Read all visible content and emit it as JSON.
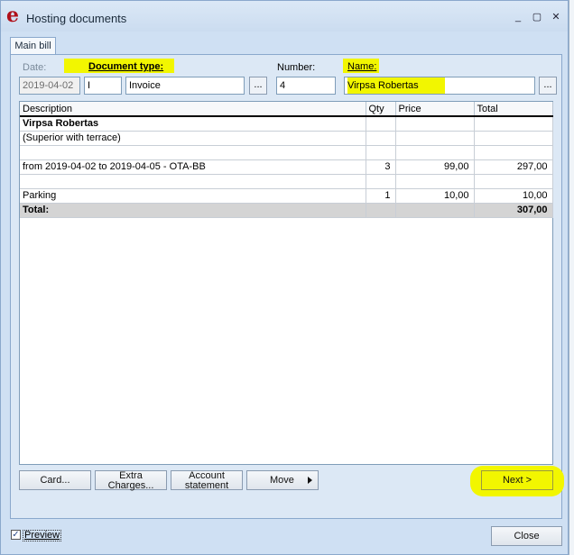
{
  "window": {
    "title": "Hosting documents",
    "controls": {
      "minimize": "_",
      "maximize": "▢",
      "close": "✕"
    }
  },
  "tabs": [
    {
      "label": "Main bill"
    }
  ],
  "form": {
    "date_label": "Date:",
    "date_value": "2019-04-02",
    "doctype_label": "Document type:",
    "doctype_code": "I",
    "doctype_name": "Invoice",
    "number_label": "Number:",
    "number_value": "4",
    "name_label": "Name:",
    "name_value": "Virpsa Robertas",
    "lookup_label": "..."
  },
  "table": {
    "headers": {
      "description": "Description",
      "qty": "Qty",
      "price": "Price",
      "total": "Total"
    },
    "rows": [
      {
        "description": "Virpsa Robertas",
        "qty": "",
        "price": "",
        "total": ""
      },
      {
        "description": "(Superior with terrace)",
        "qty": "",
        "price": "",
        "total": ""
      },
      {
        "description": "",
        "qty": "",
        "price": "",
        "total": ""
      },
      {
        "description": "from 2019-04-02 to 2019-04-05 - OTA-BB",
        "qty": "3",
        "price": "99,00",
        "total": "297,00"
      },
      {
        "description": "",
        "qty": "",
        "price": "",
        "total": ""
      },
      {
        "description": "Parking",
        "qty": "1",
        "price": "10,00",
        "total": "10,00"
      },
      {
        "description": "Total:",
        "qty": "",
        "price": "",
        "total": "307,00"
      }
    ]
  },
  "buttons": {
    "card": "Card...",
    "extra_line1": "Extra",
    "extra_line2": "Charges...",
    "account_line1": "Account",
    "account_line2": "statement",
    "move": "Move",
    "next": "Next >",
    "close": "Close"
  },
  "preview": {
    "label": "Preview",
    "checked_mark": "✓"
  },
  "colors": {
    "highlight": "#f2f600",
    "accent": "#b0101a"
  }
}
